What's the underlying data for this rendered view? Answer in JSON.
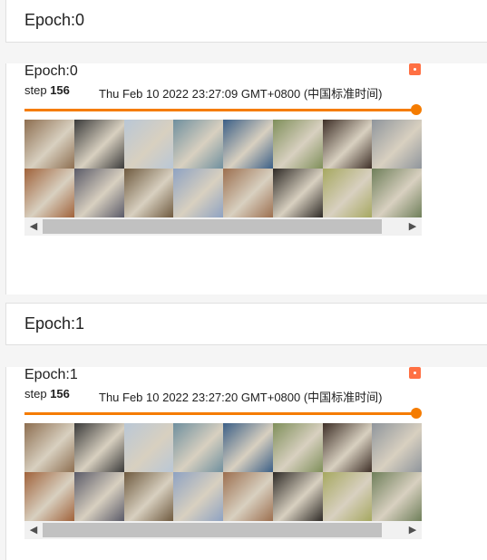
{
  "sections": [
    {
      "header": "Epoch:0",
      "card": {
        "title": "Epoch:0",
        "step_label": "step",
        "step_value": "156",
        "timestamp": "Thu Feb 10 2022 23:27:09 GMT+0800 (中国标准时间)",
        "slider_value_percent": 100
      }
    },
    {
      "header": "Epoch:1",
      "card": {
        "title": "Epoch:1",
        "step_label": "step",
        "step_value": "156",
        "timestamp": "Thu Feb 10 2022 23:27:20 GMT+0800 (中国标准时间)",
        "slider_value_percent": 100
      }
    }
  ],
  "colors": {
    "accent": "#f57c00",
    "badge": "#ff7043"
  },
  "image_tiles": [
    {
      "subject": "dog",
      "color": "#8d6e50"
    },
    {
      "subject": "dog",
      "color": "#3a3a3a"
    },
    {
      "subject": "ship",
      "color": "#b9c7d6"
    },
    {
      "subject": "airplane",
      "color": "#6f8f9e"
    },
    {
      "subject": "ship",
      "color": "#3b5f86"
    },
    {
      "subject": "deer",
      "color": "#7f8f5a"
    },
    {
      "subject": "horse",
      "color": "#3e2f27"
    },
    {
      "subject": "airplane",
      "color": "#8f959c"
    },
    {
      "subject": "cat",
      "color": "#a0623a"
    },
    {
      "subject": "dog",
      "color": "#5a5a68"
    },
    {
      "subject": "cat",
      "color": "#6f5a3f"
    },
    {
      "subject": "ship",
      "color": "#8ea2c2"
    },
    {
      "subject": "dog",
      "color": "#9c6f4f"
    },
    {
      "subject": "dog",
      "color": "#2e2a26"
    },
    {
      "subject": "automobile",
      "color": "#a6a860"
    },
    {
      "subject": "horse",
      "color": "#6f7f5a"
    }
  ],
  "icons": {
    "scroll_left": "◀",
    "scroll_right": "▶"
  }
}
